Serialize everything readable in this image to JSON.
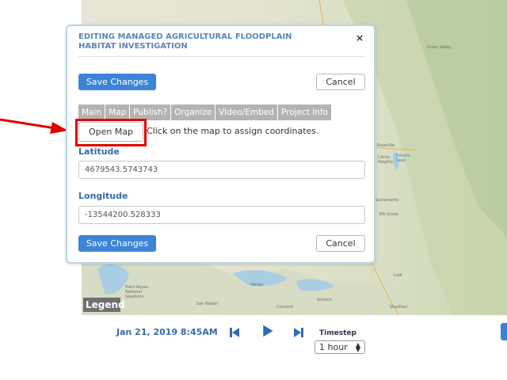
{
  "map": {
    "labels": [
      "Grass Valley",
      "Roseville",
      "Citrus Heights",
      "Folsom Lake",
      "Sacramento",
      "Elk Grove",
      "Lodi",
      "Vallejo",
      "San Rafael",
      "Point Reyes National Seashore",
      "Concord",
      "Antioch",
      "Stockton"
    ],
    "legend_label": "Legend"
  },
  "modal": {
    "title": "EDITING MANAGED AGRICULTURAL FLOODPLAIN HABITAT INVESTIGATION",
    "close_icon": "×",
    "save_label": "Save Changes",
    "cancel_label": "Cancel",
    "tabs": [
      "Main",
      "Map",
      "Publish?",
      "Organize",
      "Video/Embed",
      "Project Info"
    ],
    "open_map_label": "Open Map",
    "hint": "Click on the map to assign coordinates.",
    "latitude_label": "Latitude",
    "latitude_value": "4679543.5743743",
    "longitude_label": "Longitude",
    "longitude_value": "-13544200.528333"
  },
  "timeline": {
    "date": "Jan 21, 2019 8:45AM",
    "timestamp_label": "Timestep",
    "timestamp_value": "1 hour"
  },
  "colors": {
    "primary": "#3c84d6",
    "highlight": "#e00000",
    "label": "#3a6aa7"
  }
}
